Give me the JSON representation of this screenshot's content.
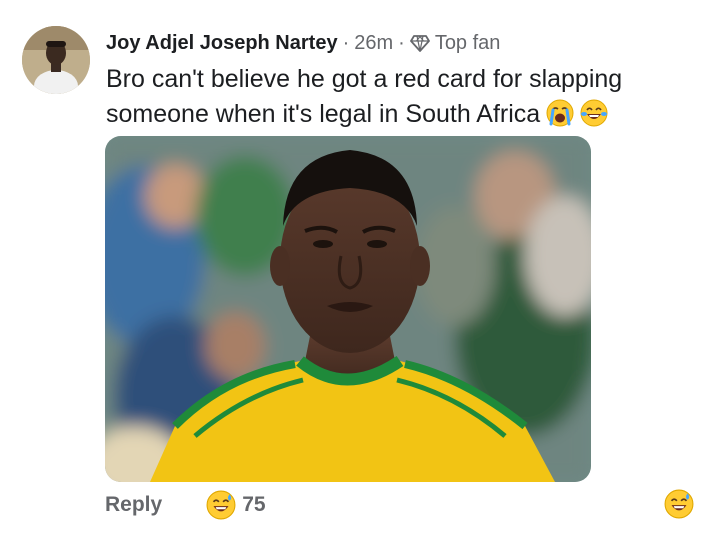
{
  "comment": {
    "author": "Joy Adjel Joseph Nartey",
    "time": "26m",
    "separator": "·",
    "badge_label": "Top fan",
    "badge_icon": "diamond-icon",
    "text": "Bro can't believe he got a red card for slapping someone when it's legal in South Africa",
    "emojis": [
      "loudly-crying-face-icon",
      "tears-of-joy-face-icon"
    ],
    "photo_alt": "Footballer in yellow and green kit"
  },
  "footer": {
    "reply_label": "Reply",
    "reaction_icon": "grinning-sweat-face-icon",
    "reaction_count": "75",
    "react_button_icon": "grinning-sweat-face-icon"
  },
  "colors": {
    "text_primary": "#1c1e21",
    "text_secondary": "#65676b",
    "kit_yellow": "#f2c414",
    "kit_green": "#1f8a3a"
  }
}
